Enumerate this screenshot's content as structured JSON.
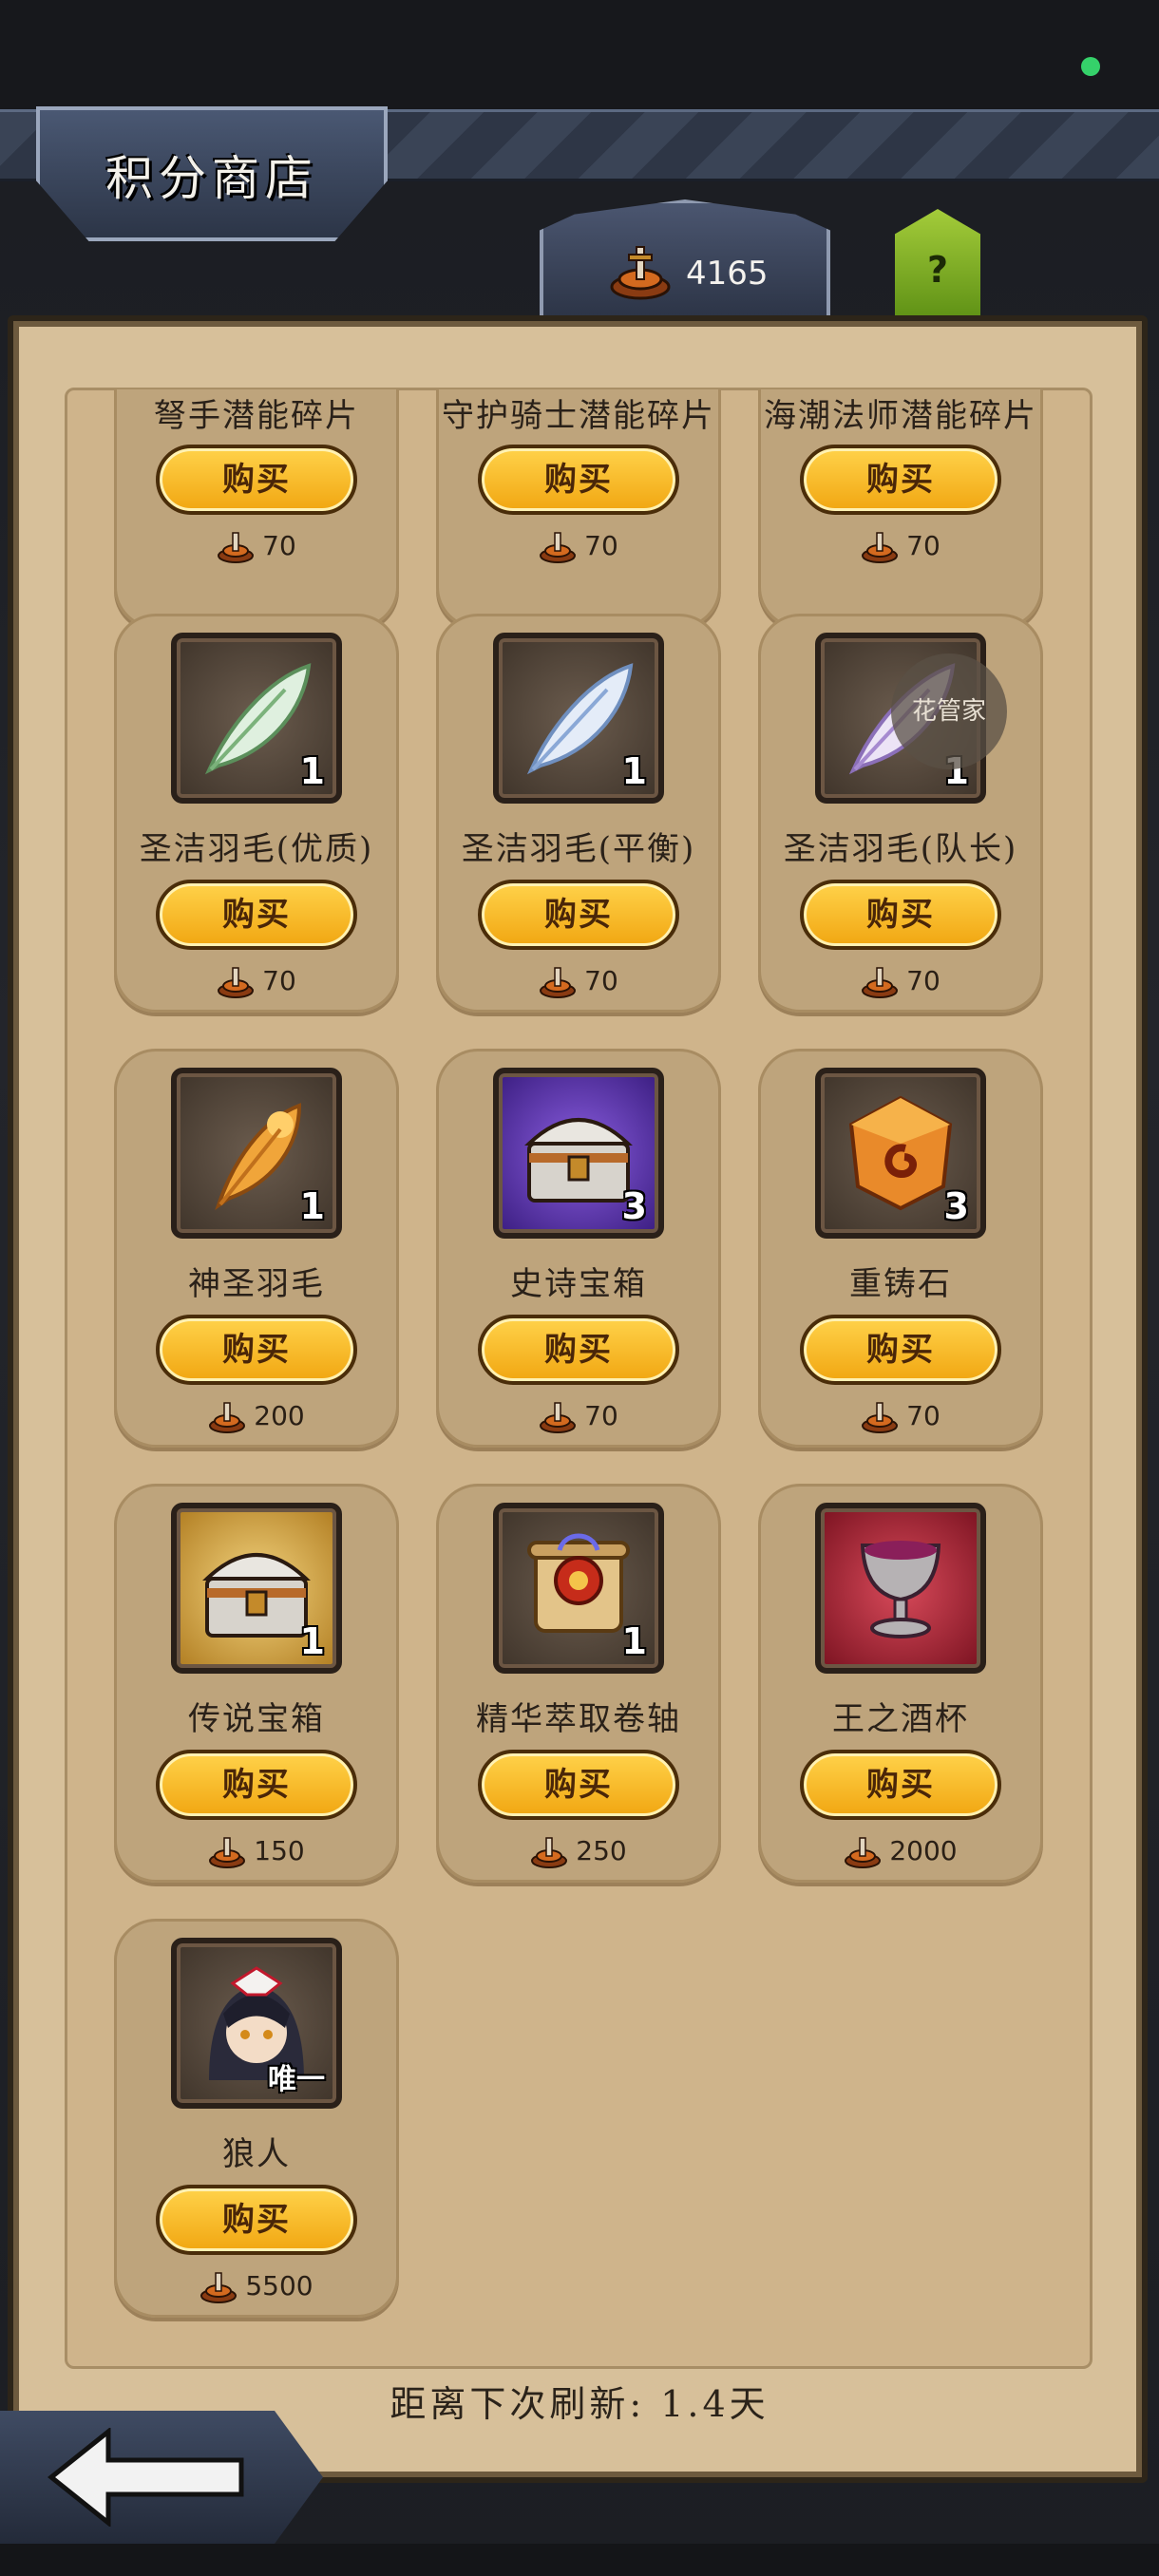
{
  "header": {
    "title": "积分商店",
    "currency_value": "4165",
    "help_label": "?"
  },
  "colors": {
    "buy_button": "#f1a611",
    "panel": "#d7c09a",
    "header": "#3a4456"
  },
  "shop": {
    "items": [
      {
        "name": "弩手潜能碎片",
        "price": "70",
        "buy_label": "购买",
        "icon": "shard-icon"
      },
      {
        "name": "守护骑士潜能碎片",
        "price": "70",
        "buy_label": "购买",
        "icon": "shard-icon"
      },
      {
        "name": "海潮法师潜能碎片",
        "price": "70",
        "buy_label": "购买",
        "icon": "shard-icon"
      },
      {
        "name": "圣洁羽毛(优质)",
        "price": "70",
        "buy_label": "购买",
        "qty": "1",
        "icon": "green-feather-icon"
      },
      {
        "name": "圣洁羽毛(平衡)",
        "price": "70",
        "buy_label": "购买",
        "qty": "1",
        "icon": "blue-feather-icon"
      },
      {
        "name": "圣洁羽毛(队长)",
        "price": "70",
        "buy_label": "购买",
        "qty": "1",
        "icon": "purple-feather-icon"
      },
      {
        "name": "神圣羽毛",
        "price": "200",
        "buy_label": "购买",
        "qty": "1",
        "icon": "golden-feather-icon"
      },
      {
        "name": "史诗宝箱",
        "price": "70",
        "buy_label": "购买",
        "qty": "3",
        "icon": "epic-chest-icon"
      },
      {
        "name": "重铸石",
        "price": "70",
        "buy_label": "购买",
        "qty": "3",
        "icon": "reforge-stone-icon"
      },
      {
        "name": "传说宝箱",
        "price": "150",
        "buy_label": "购买",
        "qty": "1",
        "icon": "legendary-chest-icon"
      },
      {
        "name": "精华萃取卷轴",
        "price": "250",
        "buy_label": "购买",
        "qty": "1",
        "icon": "scroll-icon"
      },
      {
        "name": "王之酒杯",
        "price": "2000",
        "buy_label": "购买",
        "icon": "goblet-icon"
      },
      {
        "name": "狼人",
        "price": "5500",
        "buy_label": "购买",
        "badge": "唯一",
        "icon": "werewolf-portrait-icon"
      }
    ]
  },
  "floating_assistant": "花管家",
  "refresh_text": "距离下次刷新: 1.4天"
}
